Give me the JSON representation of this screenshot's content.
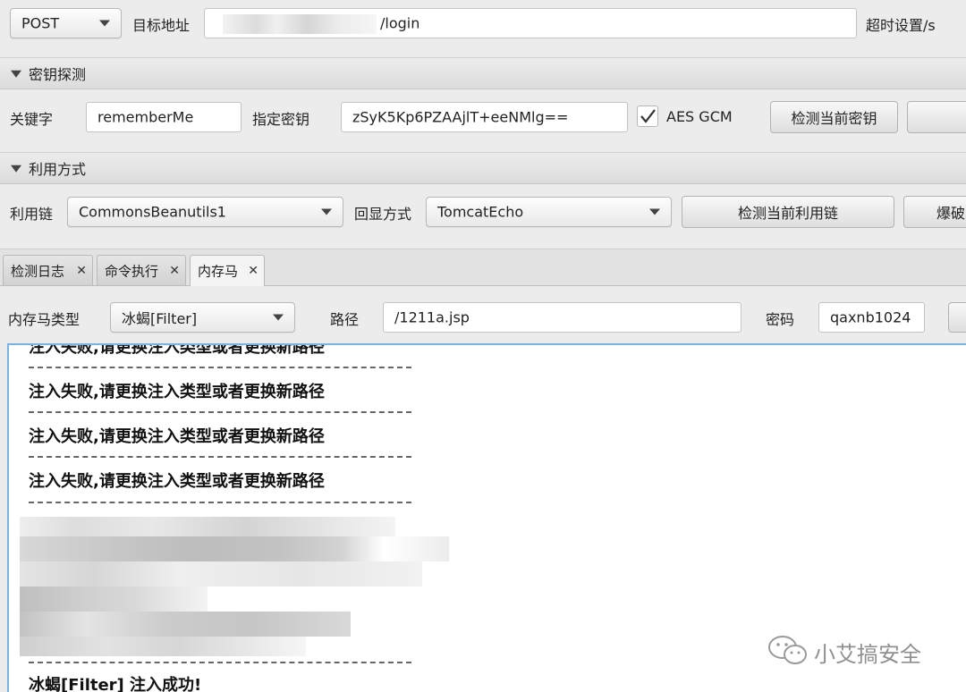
{
  "toolbar": {
    "method": "POST",
    "target_label": "目标地址",
    "target_url": "/login",
    "timeout_label": "超时设置/s"
  },
  "key_section": {
    "title": "密钥探测",
    "keyword_label": "关键字",
    "keyword_value": "rememberMe",
    "key_label": "指定密钥",
    "key_value": "zSyK5Kp6PZAAjlT+eeNMlg==",
    "aes_gcm_label": "AES GCM",
    "aes_gcm_checked": true,
    "detect_key_button": "检测当前密钥"
  },
  "exploit_section": {
    "title": "利用方式",
    "chain_label": "利用链",
    "chain_value": "CommonsBeanutils1",
    "echo_label": "回显方式",
    "echo_value": "TomcatEcho",
    "detect_chain_button": "检测当前利用链",
    "brute_button": "爆破"
  },
  "tabs": [
    {
      "label": "检测日志",
      "active": false
    },
    {
      "label": "命令执行",
      "active": false
    },
    {
      "label": "内存马",
      "active": true
    }
  ],
  "memshell": {
    "type_label": "内存马类型",
    "type_value": "冰蝎[Filter]",
    "path_label": "路径",
    "path_value": "/1211a.jsp",
    "password_label": "密码",
    "password_value": "qaxnb1024"
  },
  "log": {
    "lines": [
      "注入失败,请更换注入类型或者更换新路径",
      "注入失败,请更换注入类型或者更换新路径",
      "注入失败,请更换注入类型或者更换新路径",
      "注入失败,请更换注入类型或者更换新路径",
      "冰蝎[Filter] 注入成功!"
    ],
    "separator": "--------------------------------------------------"
  },
  "watermark": "小艾搞安全",
  "colors": {
    "focus_border": "#79b3e6",
    "background": "#ececec"
  }
}
